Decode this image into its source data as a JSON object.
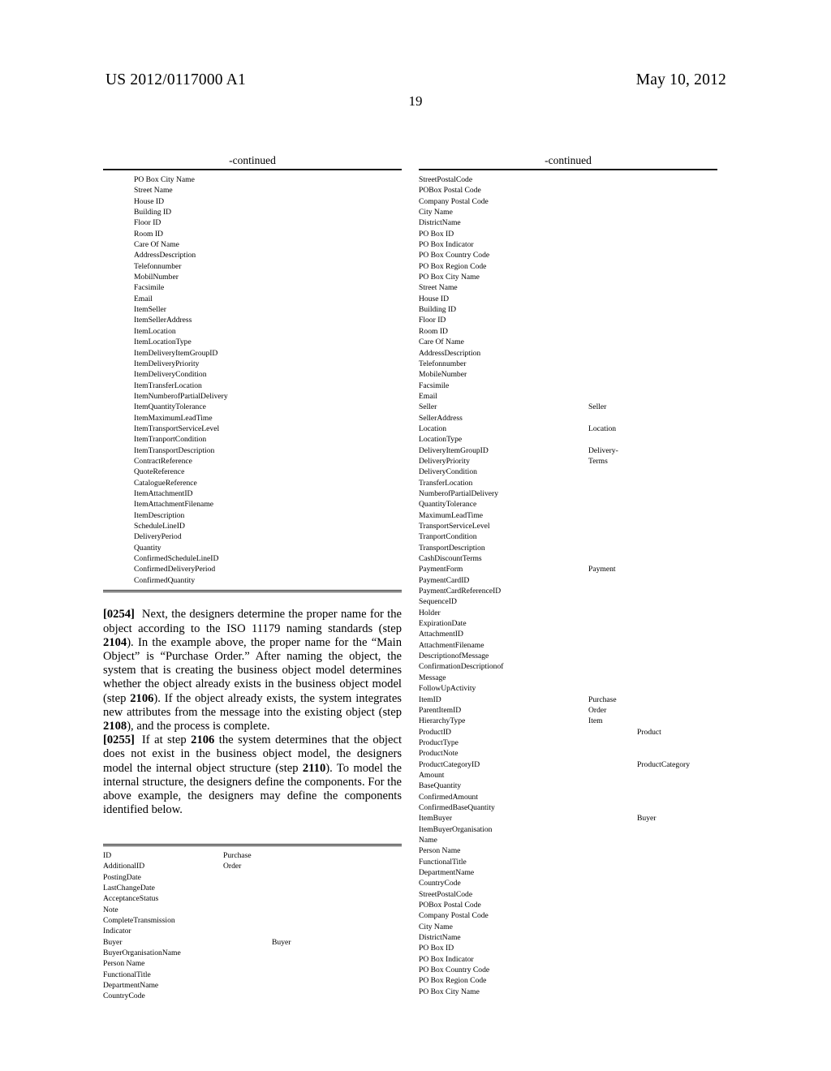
{
  "header": {
    "publication_number": "US 2012/0117000 A1",
    "publication_date": "May 10, 2012",
    "page_number": "19"
  },
  "left_column": {
    "table_continued": {
      "caption": "-continued",
      "rows": [
        {
          "c1": "PO Box City Name"
        },
        {
          "c1": "Street Name"
        },
        {
          "c1": "House ID"
        },
        {
          "c1": "Building ID"
        },
        {
          "c1": "Floor ID"
        },
        {
          "c1": "Room ID"
        },
        {
          "c1": "Care Of Name"
        },
        {
          "c1": "AddressDescription"
        },
        {
          "c1": "Telefonnumber"
        },
        {
          "c1": "MobilNumber"
        },
        {
          "c1": "Facsimile"
        },
        {
          "c1": "Email"
        },
        {
          "c1": "ItemSeller"
        },
        {
          "c1": "ItemSellerAddress"
        },
        {
          "c1": "ItemLocation"
        },
        {
          "c1": "ItemLocationType"
        },
        {
          "c1": "ItemDeliveryItemGroupID"
        },
        {
          "c1": "ItemDeliveryPriority"
        },
        {
          "c1": "ItemDeliveryCondition"
        },
        {
          "c1": "ItemTransferLocation"
        },
        {
          "c1": "ItemNumberofPartialDelivery"
        },
        {
          "c1": "ItemQuantityTolerance"
        },
        {
          "c1": "ItemMaximumLeadTime"
        },
        {
          "c1": "ItemTransportServiceLevel"
        },
        {
          "c1": "ItemTranportCondition"
        },
        {
          "c1": "ItemTransportDescription"
        },
        {
          "c1": "ContractReference"
        },
        {
          "c1": "QuoteReference"
        },
        {
          "c1": "CatalogueReference"
        },
        {
          "c1": "ItemAttachmentID"
        },
        {
          "c1": "ItemAttachmentFilename"
        },
        {
          "c1": "ItemDescription"
        },
        {
          "c1": "ScheduleLineID"
        },
        {
          "c1": "DeliveryPeriod"
        },
        {
          "c1": "Quantity"
        },
        {
          "c1": "ConfirmedScheduleLineID"
        },
        {
          "c1": "ConfirmedDeliveryPeriod"
        },
        {
          "c1": "ConfirmedQuantity"
        }
      ]
    },
    "paragraphs": [
      {
        "number": "[0254]",
        "runs": [
          {
            "t": "Next, the designers determine the proper name for the object according to the ISO 11179 naming standards (step "
          },
          {
            "t": "2104",
            "bold": true
          },
          {
            "t": "). In the example above, the proper name for the “Main Object” is “Purchase Order.” After naming the object, the system that is creating the business object model determines whether the object already exists in the business object model (step "
          },
          {
            "t": "2106",
            "bold": true
          },
          {
            "t": "). If the object already exists, the system integrates new attributes from the message into the existing object (step "
          },
          {
            "t": "2108",
            "bold": true
          },
          {
            "t": "), and the process is complete."
          }
        ]
      },
      {
        "number": "[0255]",
        "runs": [
          {
            "t": "If at step "
          },
          {
            "t": "2106",
            "bold": true
          },
          {
            "t": " the system determines that the object does not exist in the business object model, the designers model the internal object structure (step "
          },
          {
            "t": "2110",
            "bold": true
          },
          {
            "t": "). To model the internal structure, the designers define the components. For the above example, the designers may define the components identified below."
          }
        ]
      }
    ],
    "table_components": {
      "rows": [
        {
          "c1": "ID",
          "c2": "Purchase"
        },
        {
          "c1": "AdditionalID",
          "c2": "Order"
        },
        {
          "c1": "PostingDate"
        },
        {
          "c1": "LastChangeDate"
        },
        {
          "c1": "AcceptanceStatus"
        },
        {
          "c1": "Note"
        },
        {
          "c1": "CompleteTransmission"
        },
        {
          "c1": "Indicator"
        },
        {
          "c1": "Buyer",
          "c3": "Buyer"
        },
        {
          "c1": "BuyerOrganisationName"
        },
        {
          "c1": "Person Name"
        },
        {
          "c1": "FunctionalTitle"
        },
        {
          "c1": "DepartmentName"
        },
        {
          "c1": "CountryCode"
        }
      ]
    }
  },
  "right_column": {
    "table_continued": {
      "caption": "-continued",
      "rows": [
        {
          "c1": "StreetPostalCode"
        },
        {
          "c1": "POBox Postal Code"
        },
        {
          "c1": "Company Postal Code"
        },
        {
          "c1": "City Name"
        },
        {
          "c1": "DistrictName"
        },
        {
          "c1": "PO Box ID"
        },
        {
          "c1": "PO Box Indicator"
        },
        {
          "c1": "PO Box Country Code"
        },
        {
          "c1": "PO Box Region Code"
        },
        {
          "c1": "PO Box City Name"
        },
        {
          "c1": "Street Name"
        },
        {
          "c1": "House ID"
        },
        {
          "c1": "Building ID"
        },
        {
          "c1": "Floor ID"
        },
        {
          "c1": "Room ID"
        },
        {
          "c1": "Care Of Name"
        },
        {
          "c1": "AddressDescription"
        },
        {
          "c1": "Telefonnumber"
        },
        {
          "c1": "MobileNumber"
        },
        {
          "c1": "Facsimile"
        },
        {
          "c1": "Email"
        },
        {
          "c1": "Seller",
          "c2": "Seller"
        },
        {
          "c1": "SellerAddress"
        },
        {
          "c1": "Location",
          "c2": "Location"
        },
        {
          "c1": "LocationType"
        },
        {
          "c1": "DeliveryItemGroupID",
          "c2": "Delivery-"
        },
        {
          "c1": "DeliveryPriority",
          "c2": "Terms"
        },
        {
          "c1": "DeliveryCondition"
        },
        {
          "c1": "TransferLocation"
        },
        {
          "c1": "NumberofPartialDelivery"
        },
        {
          "c1": "QuantityTolerance"
        },
        {
          "c1": "MaximumLeadTime"
        },
        {
          "c1": "TransportServiceLevel"
        },
        {
          "c1": "TranportCondition"
        },
        {
          "c1": "TransportDescription"
        },
        {
          "c1": "CashDiscountTerms"
        },
        {
          "c1": "PaymentForm",
          "c2": "Payment"
        },
        {
          "c1": "PaymentCardID"
        },
        {
          "c1": "PaymentCardReferenceID"
        },
        {
          "c1": "SequenceID"
        },
        {
          "c1": "Holder"
        },
        {
          "c1": "ExpirationDate"
        },
        {
          "c1": "AttachmentID"
        },
        {
          "c1": "AttachmentFilename"
        },
        {
          "c1": "DescriptionofMessage"
        },
        {
          "c1": "ConfirmationDescriptionof"
        },
        {
          "c1": "Message"
        },
        {
          "c1": "FollowUpActivity"
        },
        {
          "c1": "ItemID",
          "c2": "Purchase"
        },
        {
          "c1": "ParentItemID",
          "c2": "Order"
        },
        {
          "c1": "HierarchyType",
          "c2": "Item"
        },
        {
          "c1": "ProductID",
          "c3": "Product"
        },
        {
          "c1": "ProductType"
        },
        {
          "c1": "ProductNote"
        },
        {
          "c1": "ProductCategoryID",
          "c3": "ProductCategory"
        },
        {
          "c1": "Amount"
        },
        {
          "c1": "BaseQuantity"
        },
        {
          "c1": "ConfirmedAmount"
        },
        {
          "c1": "ConfirmedBaseQuantity"
        },
        {
          "c1": "ItemBuyer",
          "c3": "Buyer"
        },
        {
          "c1": "ItemBuyerOrganisation"
        },
        {
          "c1": "Name"
        },
        {
          "c1": "Person Name"
        },
        {
          "c1": "FunctionalTitle"
        },
        {
          "c1": "DepartmentName"
        },
        {
          "c1": "CountryCode"
        },
        {
          "c1": "StreetPostalCode"
        },
        {
          "c1": "POBox Postal Code"
        },
        {
          "c1": "Company Postal Code"
        },
        {
          "c1": "City Name"
        },
        {
          "c1": "DistrictName"
        },
        {
          "c1": "PO Box ID"
        },
        {
          "c1": "PO Box Indicator"
        },
        {
          "c1": "PO Box Country Code"
        },
        {
          "c1": "PO Box Region Code"
        },
        {
          "c1": "PO Box City Name"
        }
      ]
    }
  }
}
